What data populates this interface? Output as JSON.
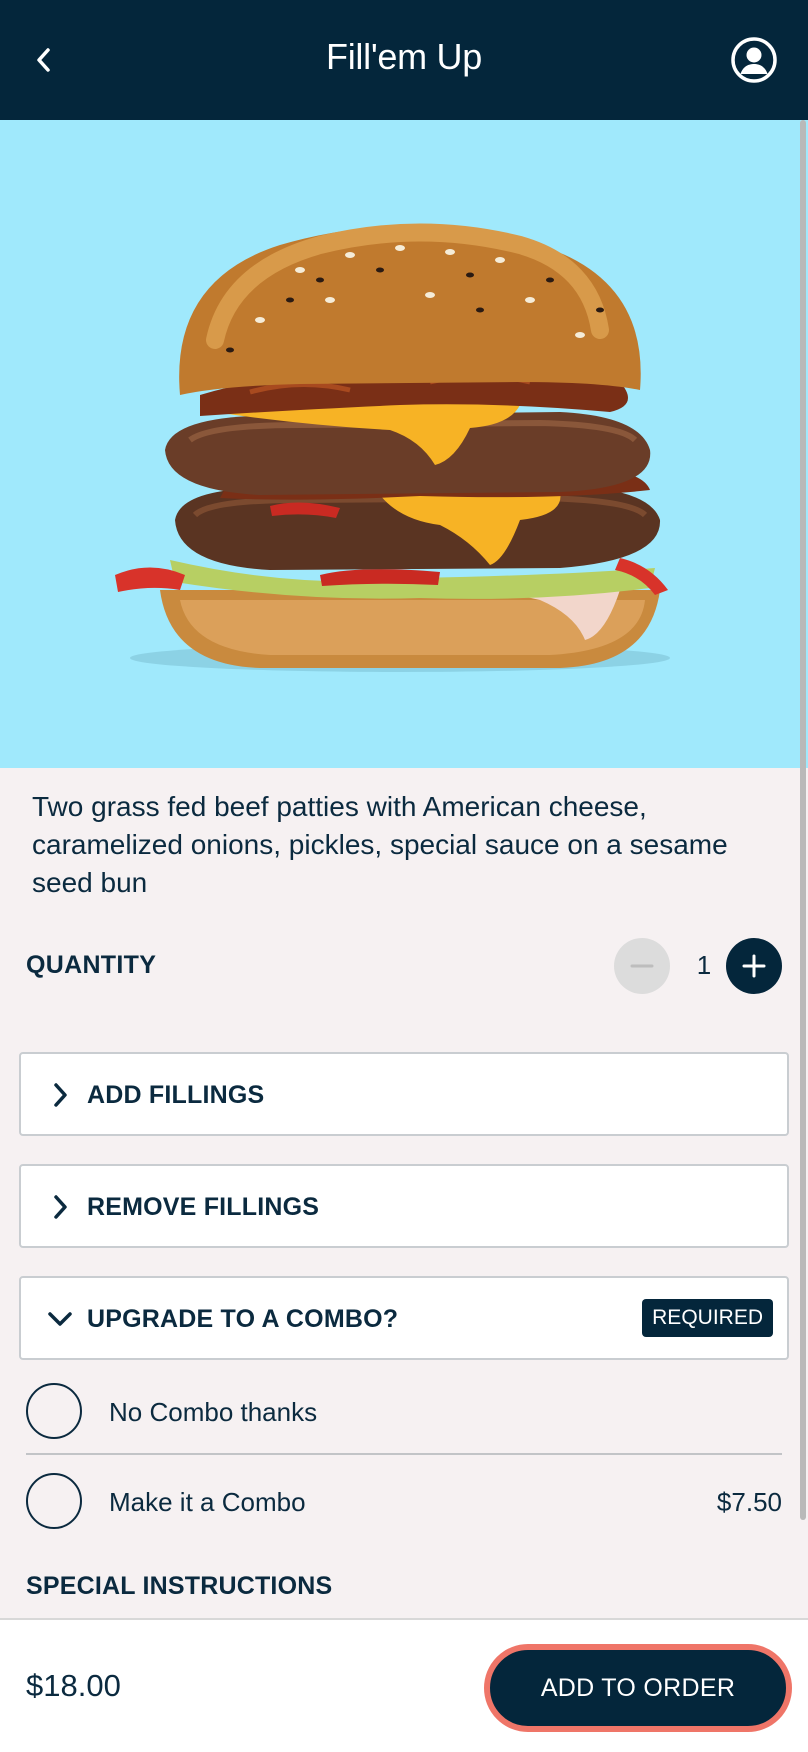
{
  "header": {
    "title": "Fill'em Up",
    "back_icon": "chevron-left-icon",
    "account_icon": "user-circle-icon"
  },
  "hero": {
    "image": "double-cheeseburger-photo",
    "background": "#a0e9fc"
  },
  "description": "Two grass fed beef patties with American cheese, caramelized onions, pickles, special sauce on a sesame seed bun",
  "quantity": {
    "label": "QUANTITY",
    "value": "1"
  },
  "sections": [
    {
      "label": "ADD FILLINGS",
      "expanded": false
    },
    {
      "label": "REMOVE FILLINGS",
      "expanded": false
    },
    {
      "label": "UPGRADE TO A COMBO?",
      "expanded": true,
      "badge": "REQUIRED"
    }
  ],
  "combo_options": [
    {
      "label": "No Combo thanks",
      "price": ""
    },
    {
      "label": "Make it a Combo",
      "price": "$7.50"
    }
  ],
  "special_instructions": {
    "label": "SPECIAL INSTRUCTIONS"
  },
  "footer": {
    "total": "$18.00",
    "add_label": "ADD TO ORDER"
  },
  "colors": {
    "navy": "#04263b",
    "accent": "#ef7568",
    "sky": "#a0e9fc"
  }
}
